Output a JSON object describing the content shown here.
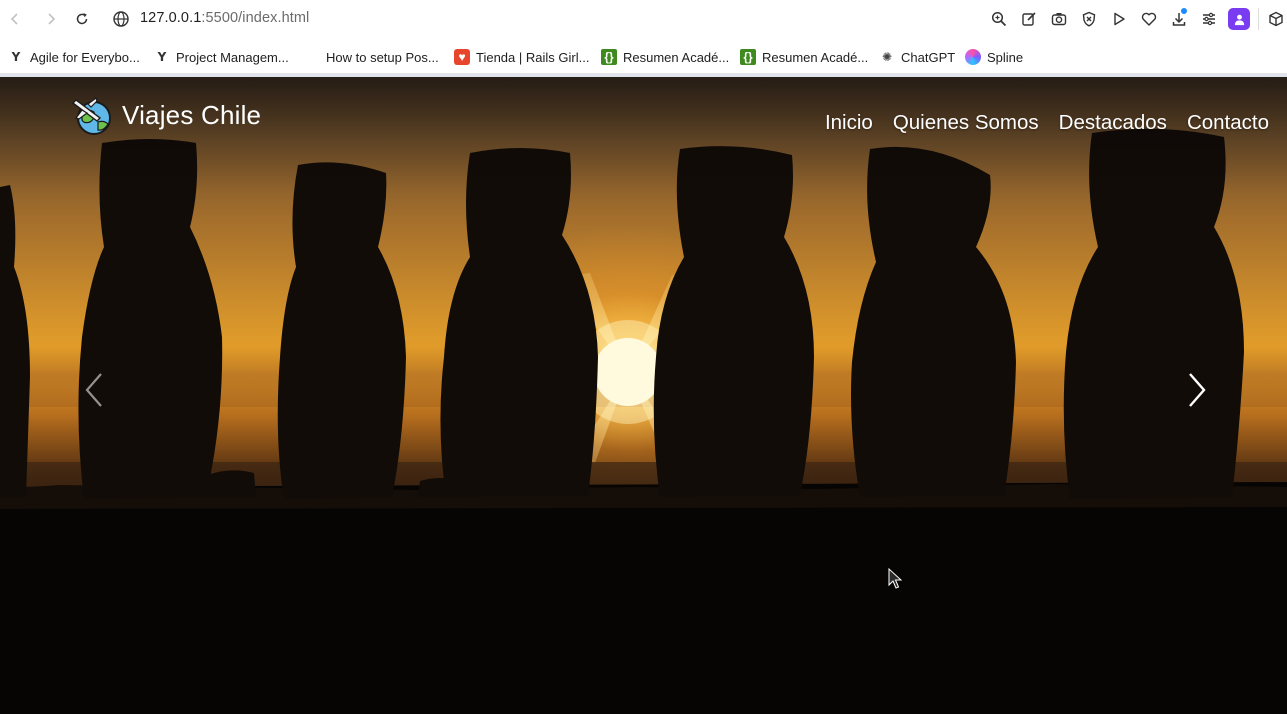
{
  "browser": {
    "url_host": "127.0.0.1",
    "url_path": ":5500/index.html",
    "toolbar_icons": [
      "zoom-icon",
      "edit-icon",
      "camera-icon",
      "shield-icon",
      "play-icon",
      "heart-icon",
      "download-icon",
      "menu-lines-icon",
      "profile-icon",
      "extension-cube-icon"
    ],
    "bookmarks": [
      {
        "label": "Agile for Everybo...",
        "icon": "v-favicon-icon"
      },
      {
        "label": "Project Managem...",
        "icon": "v-favicon-icon"
      },
      {
        "label": "How to setup Pos...",
        "icon": ""
      },
      {
        "label": "Tienda | Rails Girl...",
        "icon": "heart-favicon-icon"
      },
      {
        "label": "Resumen Acadé...",
        "icon": "green-bracket-favicon-icon"
      },
      {
        "label": "Resumen Acadé...",
        "icon": "green-bracket-favicon-icon"
      },
      {
        "label": "ChatGPT",
        "icon": "chatgpt-icon"
      },
      {
        "label": "Spline",
        "icon": "spline-icon"
      }
    ],
    "colors": {
      "profile_accent": "#7a3cf0",
      "download_dot": "#1a8cff"
    }
  },
  "site": {
    "brand": "Viajes Chile",
    "nav": [
      "Inicio",
      "Quienes Somos",
      "Destacados",
      "Contacto"
    ],
    "hero_image": "moai-sunset",
    "carousel": {
      "prev_icon": "chevron-left-icon",
      "next_icon": "chevron-right-icon"
    }
  }
}
